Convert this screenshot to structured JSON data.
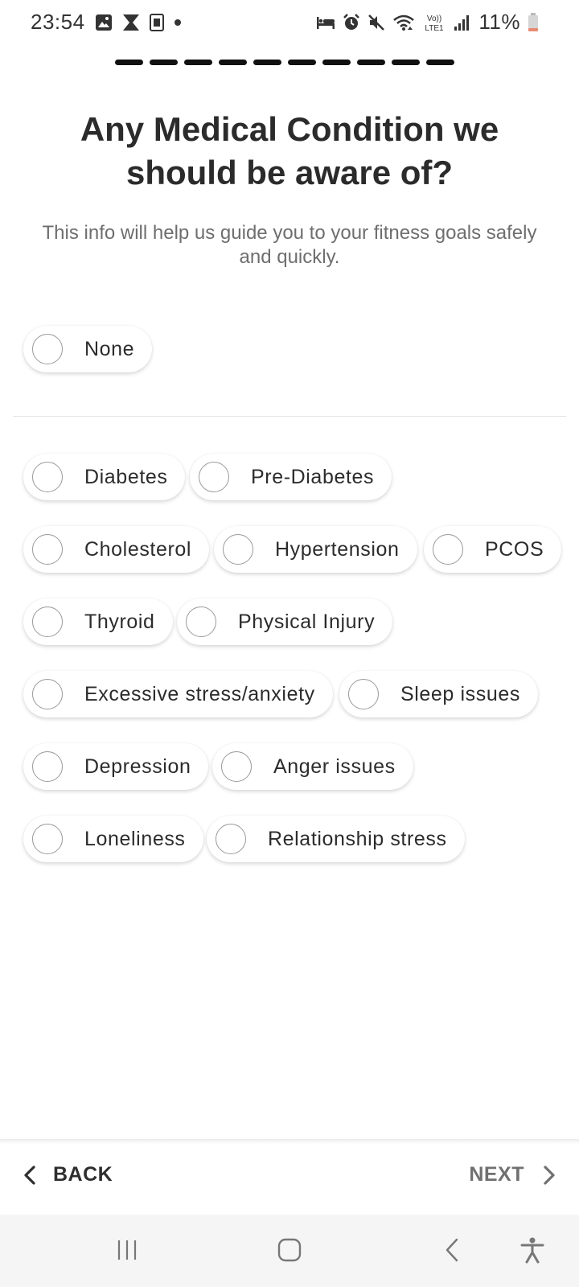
{
  "status_bar": {
    "time": "23:54",
    "battery": "11%",
    "left_icons": [
      "gallery-icon",
      "hourglass-icon",
      "keyboard-icon",
      "dot-icon"
    ],
    "right_icons": [
      "bed-icon",
      "alarm-icon",
      "mute-icon",
      "wifi-icon",
      "volte-icon",
      "signal-icon",
      "battery-icon"
    ],
    "volte_text": "Vo)) LTE1"
  },
  "progress": {
    "steps_total": 10,
    "steps_complete": 10
  },
  "header": {
    "title": "Any Medical Condition we should be aware of?",
    "subtitle": "This info will help us guide you to your fitness goals safely and quickly."
  },
  "options": {
    "none": "None",
    "conditions": [
      "Diabetes",
      "Pre-Diabetes",
      "Cholesterol",
      "Hypertension",
      "PCOS",
      "Thyroid",
      "Physical Injury",
      "Excessive stress/anxiety",
      "Sleep issues",
      "Depression",
      "Anger issues",
      "Loneliness",
      "Relationship stress"
    ]
  },
  "navigation": {
    "back_label": "BACK",
    "next_label": "NEXT"
  },
  "system_nav": {
    "icons": [
      "recents-icon",
      "home-icon",
      "back-icon",
      "accessibility-icon"
    ]
  },
  "colors": {
    "accent_dark": "#111111",
    "text": "#2c2c2c",
    "muted": "#6e6e6e",
    "next_disabled": "#707070",
    "battery_low": "#e88a72"
  }
}
